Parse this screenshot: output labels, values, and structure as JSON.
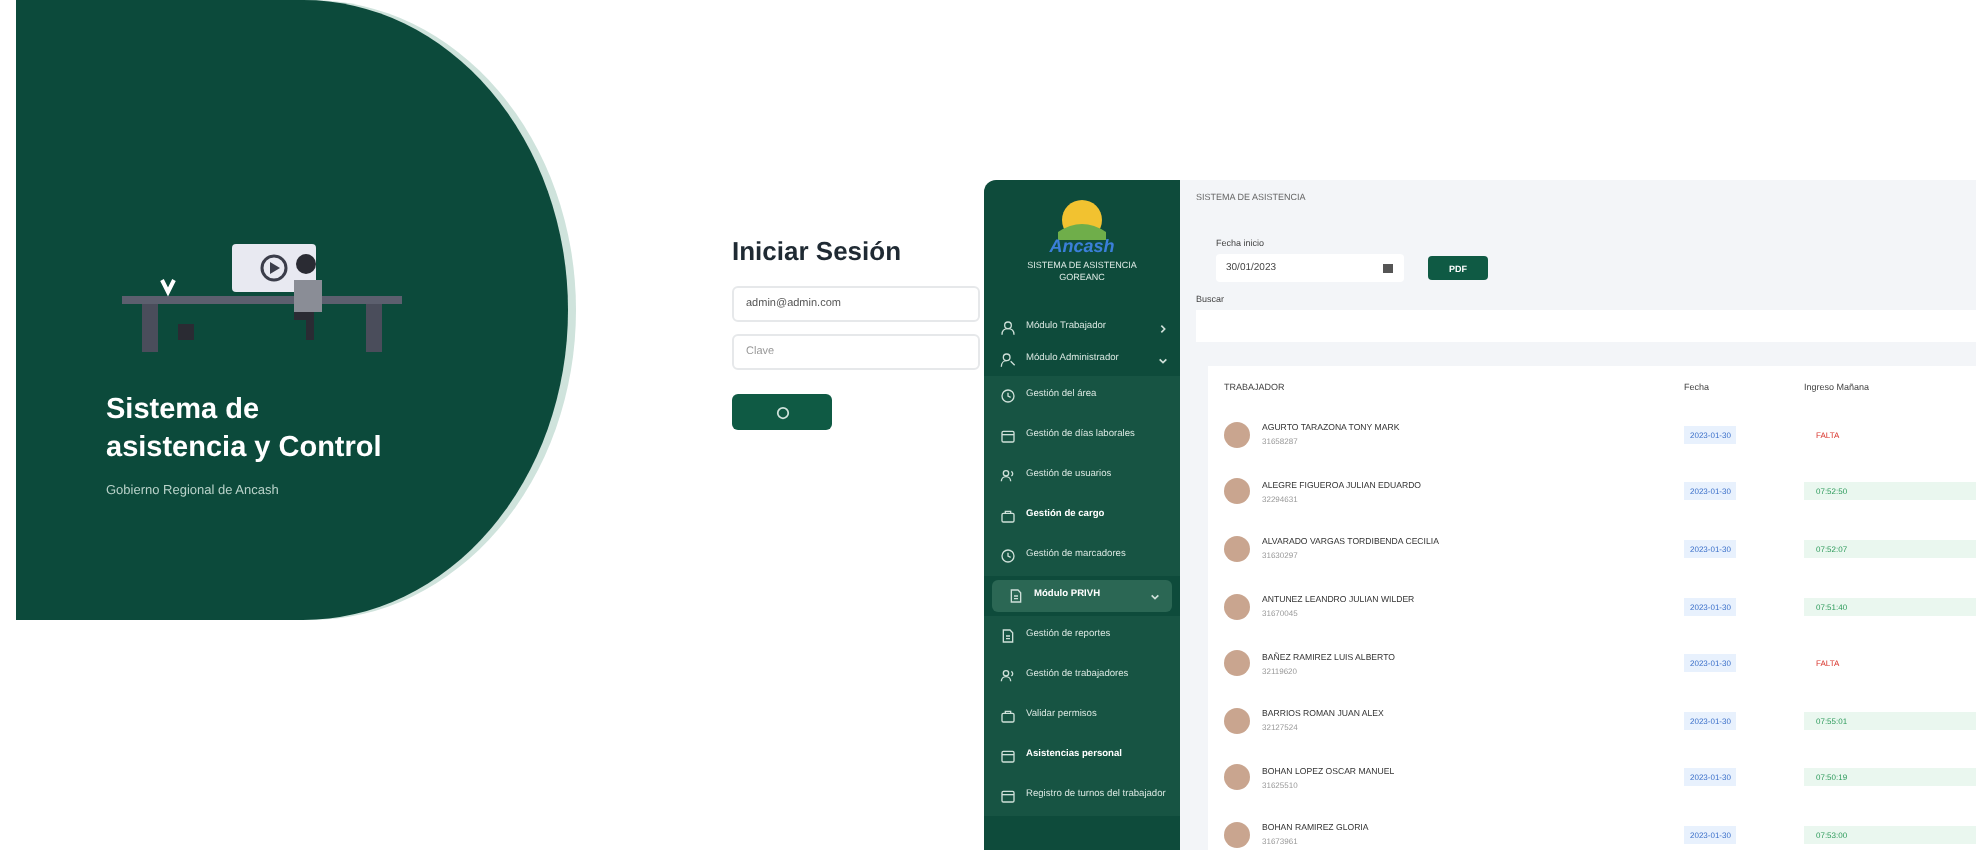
{
  "hero": {
    "title": "Sistema de asistencia y Control",
    "subtitle": "Gobierno Regional de Ancash"
  },
  "login": {
    "title": "Iniciar Sesión",
    "email": {
      "value": "admin@admin.com"
    },
    "password": {
      "placeholder": "Clave"
    }
  },
  "dashboard": {
    "brand": {
      "logo_text": "Ancash",
      "name": "SISTEMA DE ASISTENCIA GOREANC"
    },
    "sidebar": {
      "items": [
        {
          "label": "Módulo Trabajador",
          "selected": false,
          "expanded": false,
          "bold": false
        },
        {
          "label": "Módulo Administrador",
          "selected": false,
          "expanded": true,
          "bold": false,
          "children": [
            {
              "label": "Gestión del área",
              "selected": false,
              "bold": false
            },
            {
              "label": "Gestión de días laborales",
              "selected": false,
              "bold": false
            },
            {
              "label": "Gestión de usuarios",
              "selected": false,
              "bold": false
            },
            {
              "label": "Gestión de cargo",
              "selected": false,
              "bold": true
            },
            {
              "label": "Gestión de marcadores",
              "selected": false,
              "bold": false
            }
          ]
        },
        {
          "label": "Módulo PRIVH",
          "selected": true,
          "expanded": true,
          "bold": true,
          "children": [
            {
              "label": "Gestión de reportes",
              "selected": false,
              "bold": false
            },
            {
              "label": "Gestión de trabajadores",
              "selected": false,
              "bold": false
            },
            {
              "label": "Validar permisos",
              "selected": false,
              "bold": false
            },
            {
              "label": "Asistencias personal",
              "selected": false,
              "bold": true
            },
            {
              "label": "Registro de turnos del trabajador",
              "selected": false,
              "bold": false
            }
          ]
        }
      ]
    },
    "breadcrumb": "SISTEMA DE ASISTENCIA",
    "date_filter": {
      "label": "Fecha inicio",
      "value": "30/01/2023"
    },
    "pdf_button": "PDF",
    "search": {
      "label": "Buscar"
    },
    "table": {
      "columns": [
        "TRABAJADOR",
        "Fecha",
        "Ingreso Mañana"
      ],
      "rows": [
        {
          "name": "AGURTO TARAZONA TONY MARK",
          "code": "31658287",
          "date": "2023-01-30",
          "entry": "FALTA",
          "kind": "absent"
        },
        {
          "name": "ALEGRE FIGUEROA JULIAN EDUARDO",
          "code": "32294631",
          "date": "2023-01-30",
          "entry": "07:52:50",
          "kind": "present"
        },
        {
          "name": "ALVARADO VARGAS TORDIBENDA CECILIA",
          "code": "31630297",
          "date": "2023-01-30",
          "entry": "07:52:07",
          "kind": "present"
        },
        {
          "name": "ANTUNEZ LEANDRO JULIAN WILDER",
          "code": "31670045",
          "date": "2023-01-30",
          "entry": "07:51:40",
          "kind": "present"
        },
        {
          "name": "BAÑEZ RAMIREZ LUIS ALBERTO",
          "code": "32119620",
          "date": "2023-01-30",
          "entry": "FALTA",
          "kind": "absent"
        },
        {
          "name": "BARRIOS ROMAN JUAN ALEX",
          "code": "32127524",
          "date": "2023-01-30",
          "entry": "07:55:01",
          "kind": "present"
        },
        {
          "name": "BOHAN LOPEZ OSCAR MANUEL",
          "code": "31625510",
          "date": "2023-01-30",
          "entry": "07:50:19",
          "kind": "present"
        },
        {
          "name": "BOHAN RAMIREZ GLORIA",
          "code": "31673961",
          "date": "2023-01-30",
          "entry": "07:53:00",
          "kind": "present"
        }
      ]
    }
  }
}
